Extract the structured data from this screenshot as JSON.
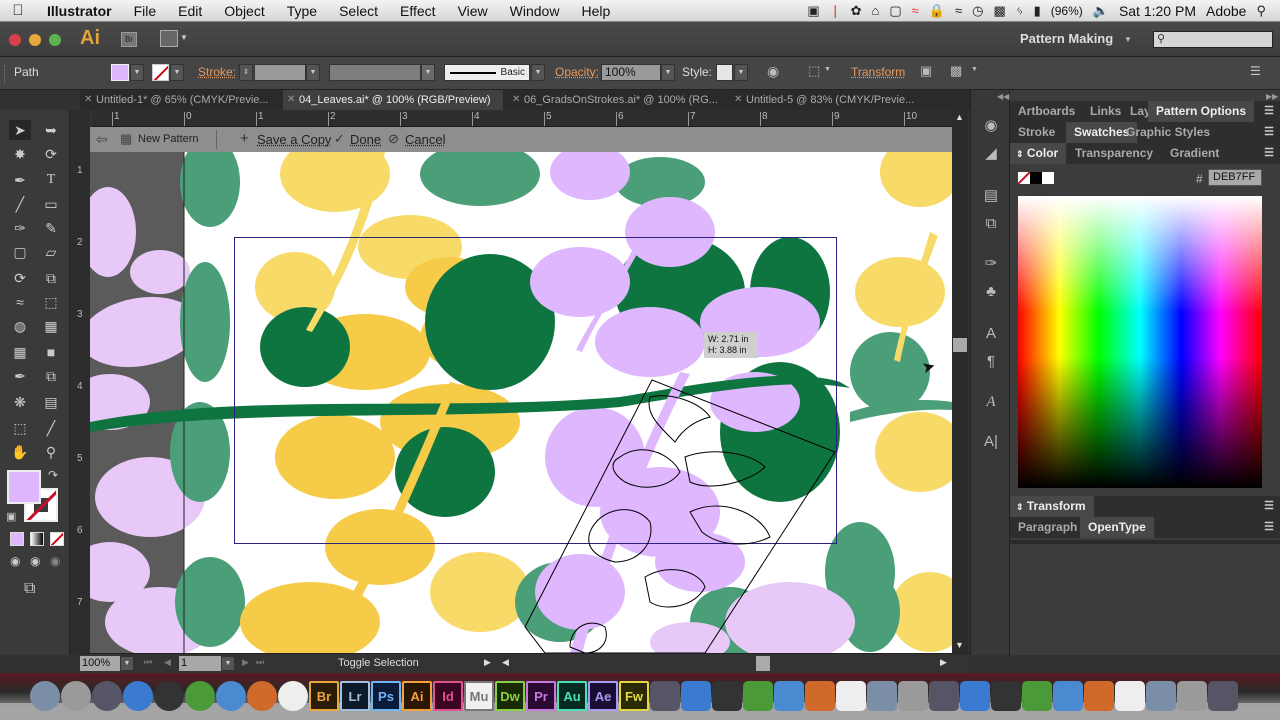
{
  "menubar": {
    "app_name": "Illustrator",
    "items": [
      "File",
      "Edit",
      "Object",
      "Type",
      "Select",
      "Effect",
      "View",
      "Window",
      "Help"
    ],
    "battery": "(96%)",
    "clock": "Sat 1:20 PM",
    "user": "Adobe"
  },
  "appbar": {
    "logo": "Ai",
    "bridge_label": "Br",
    "workspace": "Pattern Making",
    "search_value": ""
  },
  "control_bar": {
    "selection_type": "Path",
    "fill_color": "#DEB7FF",
    "stroke_label": "Stroke:",
    "stroke_value": "",
    "variable_width": "",
    "brush_label": "Basic",
    "opacity_label": "Opacity:",
    "opacity_value": "100%",
    "style_label": "Style:",
    "transform_label": "Transform"
  },
  "doc_tabs": [
    {
      "label": "Untitled-1* @ 65% (CMYK/Previe...",
      "active": false
    },
    {
      "label": "04_Leaves.ai* @ 100% (RGB/Preview)",
      "active": true
    },
    {
      "label": "06_GradsOnStrokes.ai* @ 100% (RG...",
      "active": false
    },
    {
      "label": "Untitled-5 @ 83% (CMYK/Previe...",
      "active": false
    }
  ],
  "ruler": {
    "h_labels": [
      "1",
      "0",
      "1",
      "2",
      "3",
      "4",
      "5",
      "6",
      "7",
      "8",
      "9",
      "10"
    ],
    "v_labels": [
      "1",
      "2",
      "3",
      "4",
      "5",
      "6",
      "7"
    ]
  },
  "pattern_bar": {
    "pattern_name": "New Pattern",
    "save_copy": "Save a Copy",
    "done": "Done",
    "cancel": "Cancel"
  },
  "canvas": {
    "measure_w": "W: 2.71 in",
    "measure_h": "H: 3.88 in",
    "colors": {
      "yellow": "#F5CB47",
      "light_yellow": "#F7DA67",
      "dark_green": "#0E7541",
      "mid_green": "#4A9E78",
      "lilac": "#DEB7FF",
      "light_lilac": "#E7C8F7",
      "tile_border": "#2B2280"
    }
  },
  "status_bar": {
    "zoom": "100%",
    "artboard": "1",
    "status_text": "Toggle Selection"
  },
  "panels": {
    "group1_tabs": [
      "Artboards",
      "Links",
      "Layers",
      "Pattern Options"
    ],
    "group1_active": "Pattern Options",
    "group2_tabs": [
      "Stroke",
      "Swatches",
      "Graphic Styles"
    ],
    "group2_active": "Swatches",
    "group3_tabs": [
      "Color",
      "Transparency",
      "Gradient"
    ],
    "group3_active": "Color",
    "hex_label": "#",
    "hex_value": "DEB7FF",
    "group4_tabs": [
      "Transform"
    ],
    "group5_tabs": [
      "Paragraph",
      "OpenType"
    ],
    "group5_active": "OpenType"
  },
  "toolbox": {
    "fill_color": "#DEB7FF",
    "stroke": "none"
  },
  "dock": {
    "apps": [
      "Finder",
      "Launchpad",
      "Dashboard",
      "App Store",
      "Mission Control",
      "Chrome",
      "Safari",
      "Firefox",
      "Acrobat",
      "Br",
      "Lr",
      "Ps",
      "Ai",
      "Id",
      "Mu",
      "Dw",
      "Pr",
      "Au",
      "Ae",
      "Fw",
      "Edge Animate",
      "Photo",
      "Layout",
      "iBooks",
      "Preview",
      "Zotero",
      "Photo Booth",
      "Keynote",
      "iMovie",
      "iTunes",
      "QuickTime",
      "Time Machine",
      "System Preferences",
      "Screen Share",
      "AirDrop",
      "Applications",
      "Documents",
      "Downloads",
      "Trash"
    ]
  }
}
